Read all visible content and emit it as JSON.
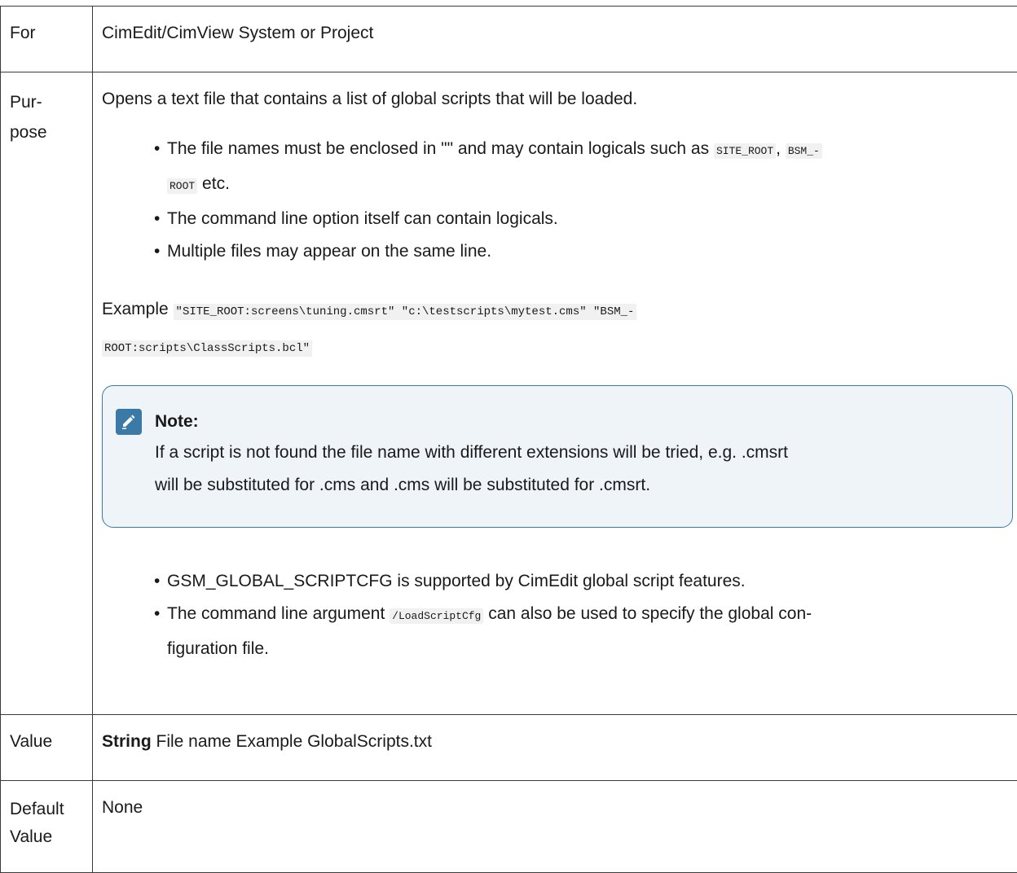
{
  "rows": {
    "for": {
      "key": "For",
      "value": "CimEdit/CimView System or Project"
    },
    "purpose": {
      "key_line1": "Pur-",
      "key_line2": "pose",
      "intro": "Opens a text file that contains a list of global scripts that will be loaded.",
      "bullets1": [
        {
          "text_before": "The file names must be enclosed in \"\" and may contain logicals such as ",
          "code1": "SITE_ROOT",
          "text_mid": ", ",
          "code2": "BSM_-",
          "code3": "ROOT",
          "text_after": " etc."
        },
        {
          "text": "The command line option itself can contain logicals."
        },
        {
          "text": "Multiple files may appear on the same line."
        }
      ],
      "example_label": "Example",
      "example_code_line1": "\"SITE_ROOT:screens\\tuning.cmsrt\" \"c:\\testscripts\\mytest.cms\" \"BSM_-",
      "example_code_line2": "ROOT:scripts\\ClassScripts.bcl\"",
      "note": {
        "title": "Note:",
        "line1": "If a script is not found the file name with different extensions will be tried, e.g. .cmsrt",
        "line2": "will be substituted for .cms and .cms will be substituted for .cmsrt."
      },
      "bullets2": [
        {
          "text": "GSM_GLOBAL_SCRIPTCFG is supported by CimEdit global script features."
        },
        {
          "text_before": "The command line argument ",
          "code": "/LoadScriptCfg",
          "text_after": " can also be used to specify the global con-",
          "text_line2": "figuration file."
        }
      ]
    },
    "value": {
      "key": "Value",
      "type_label": "String",
      "description": " File name Example GlobalScripts.txt"
    },
    "default": {
      "key_line1": "Default",
      "key_line2": "Value",
      "value": "None"
    }
  },
  "icons": {
    "note": "pencil-icon"
  },
  "colors": {
    "note_border": "#3b7aa6",
    "note_background": "#eef4f8",
    "table_border": "#3a3a3a"
  }
}
